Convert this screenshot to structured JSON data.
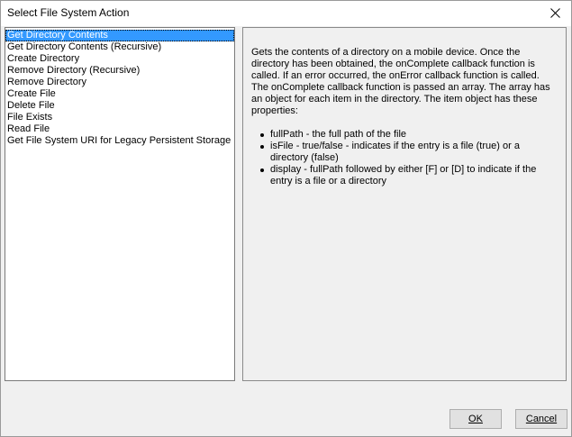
{
  "window": {
    "title": "Select File System Action"
  },
  "actions": {
    "items": [
      {
        "label": "Get Directory Contents",
        "selected": true
      },
      {
        "label": "Get Directory Contents (Recursive)",
        "selected": false
      },
      {
        "label": "Create Directory",
        "selected": false
      },
      {
        "label": "Remove Directory (Recursive)",
        "selected": false
      },
      {
        "label": "Remove Directory",
        "selected": false
      },
      {
        "label": "Create File",
        "selected": false
      },
      {
        "label": "Delete File",
        "selected": false
      },
      {
        "label": "File Exists",
        "selected": false
      },
      {
        "label": "Read File",
        "selected": false
      },
      {
        "label": "Get File System URI for Legacy Persistent Storage",
        "selected": false
      }
    ]
  },
  "description": {
    "paragraph": "Gets the contents of a directory on a mobile device. Once the directory has been obtained, the onComplete callback function is called. If an error occurred, the onError callback function is called. The onComplete callback function is passed an array. The array has an object for each item in the directory. The item object has these properties:",
    "bullets": [
      "fullPath - the full path of the file",
      "isFile - true/false - indicates if the entry is a file (true) or a directory (false)",
      "display - fullPath followed by either [F] or [D] to indicate if the entry is a file or a directory"
    ]
  },
  "buttons": {
    "ok_label": "OK",
    "cancel_label": "Cancel"
  },
  "colors": {
    "selection": "#3399ff",
    "window_bg": "#f0f0f0"
  },
  "icons": {
    "close": "close-icon"
  }
}
